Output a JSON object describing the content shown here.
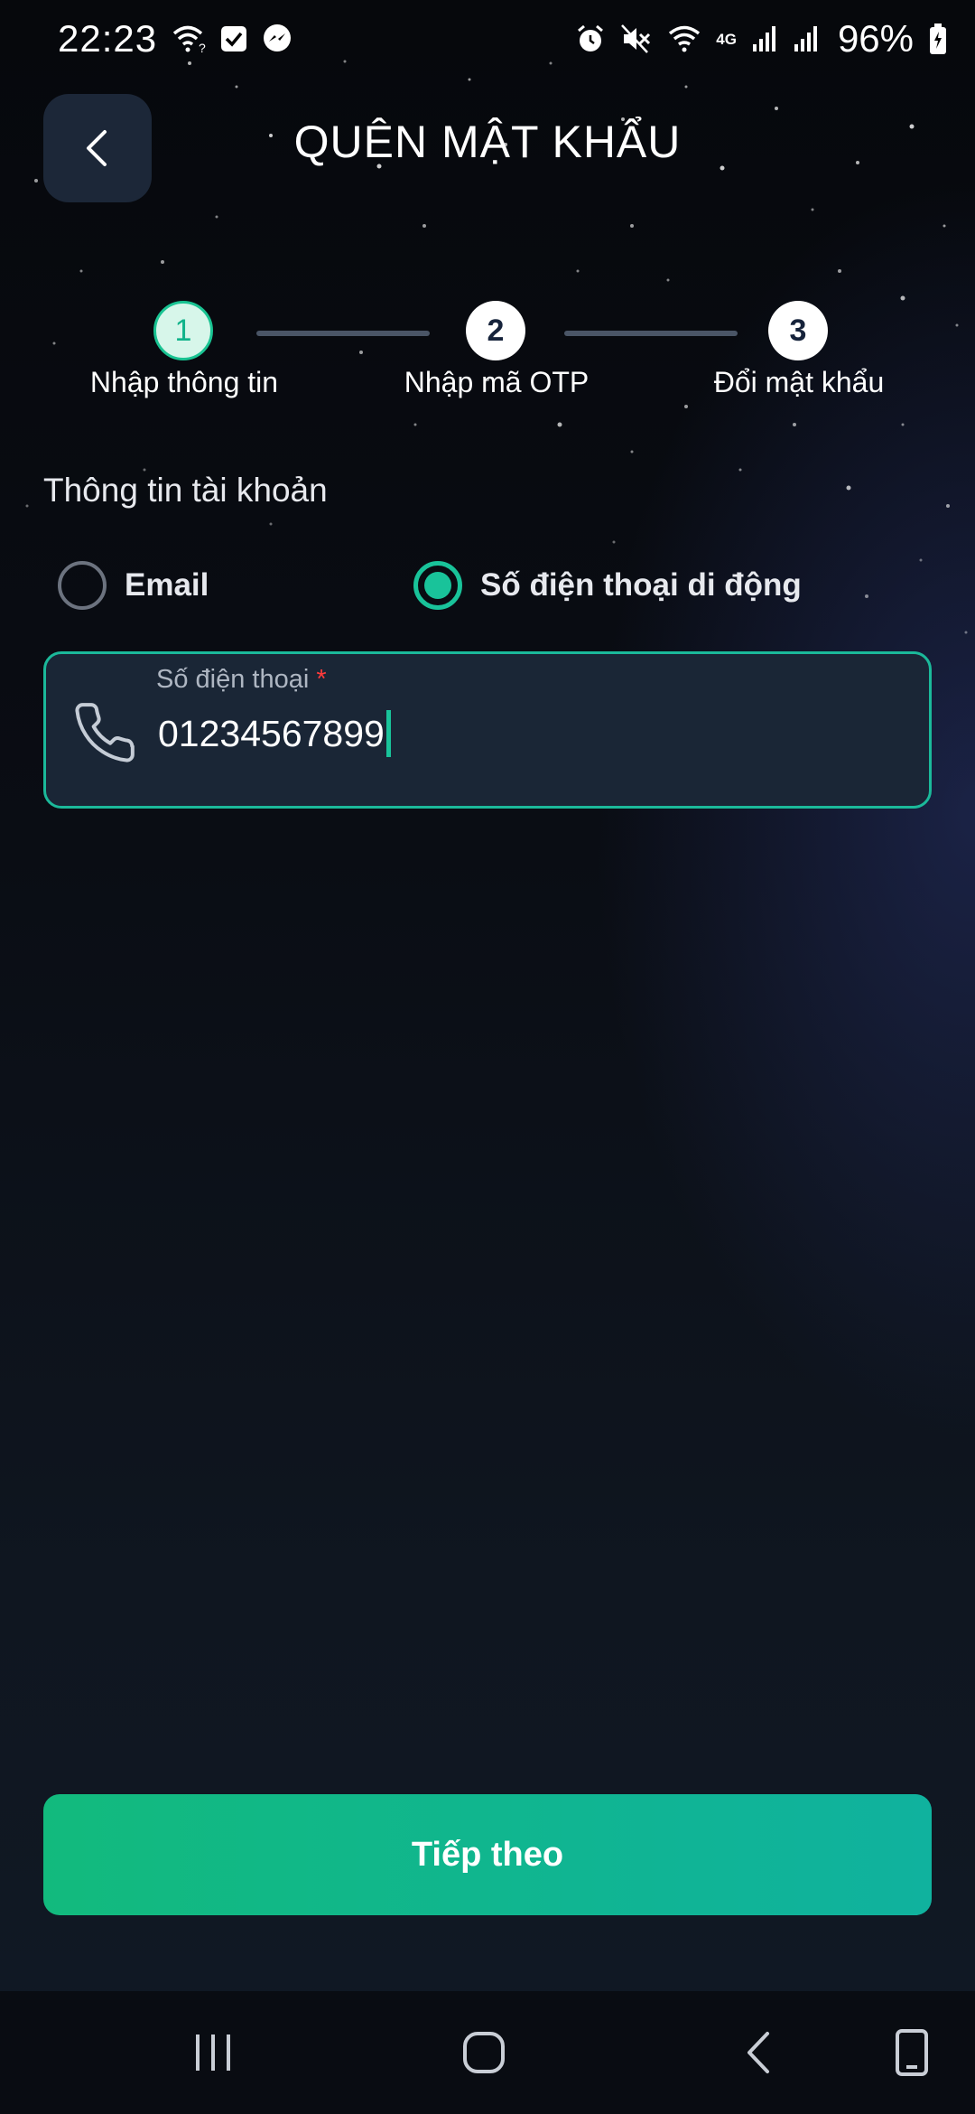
{
  "status_bar": {
    "time": "22:23",
    "battery_percent": "96%",
    "network_label": "4G",
    "left_icons": [
      "wifi-question-icon",
      "check-box-icon",
      "messenger-icon"
    ],
    "right_icons": [
      "alarm-icon",
      "mute-icon",
      "wifi-icon",
      "signal-icon",
      "signal-icon",
      "battery-charging-icon"
    ]
  },
  "header": {
    "title": "QUÊN MẬT KHẨU",
    "back_icon": "chevron-left-icon"
  },
  "stepper": {
    "steps": [
      {
        "number": "1",
        "label": "Nhập thông tin",
        "state": "active"
      },
      {
        "number": "2",
        "label": "Nhập mã OTP",
        "state": "inactive"
      },
      {
        "number": "3",
        "label": "Đổi mật khẩu",
        "state": "inactive"
      }
    ]
  },
  "form": {
    "section_label": "Thông tin tài khoản",
    "options": [
      {
        "label": "Email",
        "selected": false
      },
      {
        "label": "Số điện thoại di động",
        "selected": true
      }
    ],
    "phone_field": {
      "label": "Số điện thoại",
      "required_mark": "*",
      "value": "01234567899",
      "icon": "phone-icon"
    }
  },
  "next_button": {
    "label": "Tiếp theo"
  },
  "nav_bar": {
    "icons": [
      "recent-apps-icon",
      "home-icon",
      "back-icon",
      "screen-rotate-icon"
    ]
  },
  "colors": {
    "accent": "#19C39A",
    "button_gradient_start": "#12BA7D",
    "button_gradient_end": "#10B29E",
    "field_background": "#1A2636",
    "required": "#FF3B3B"
  }
}
